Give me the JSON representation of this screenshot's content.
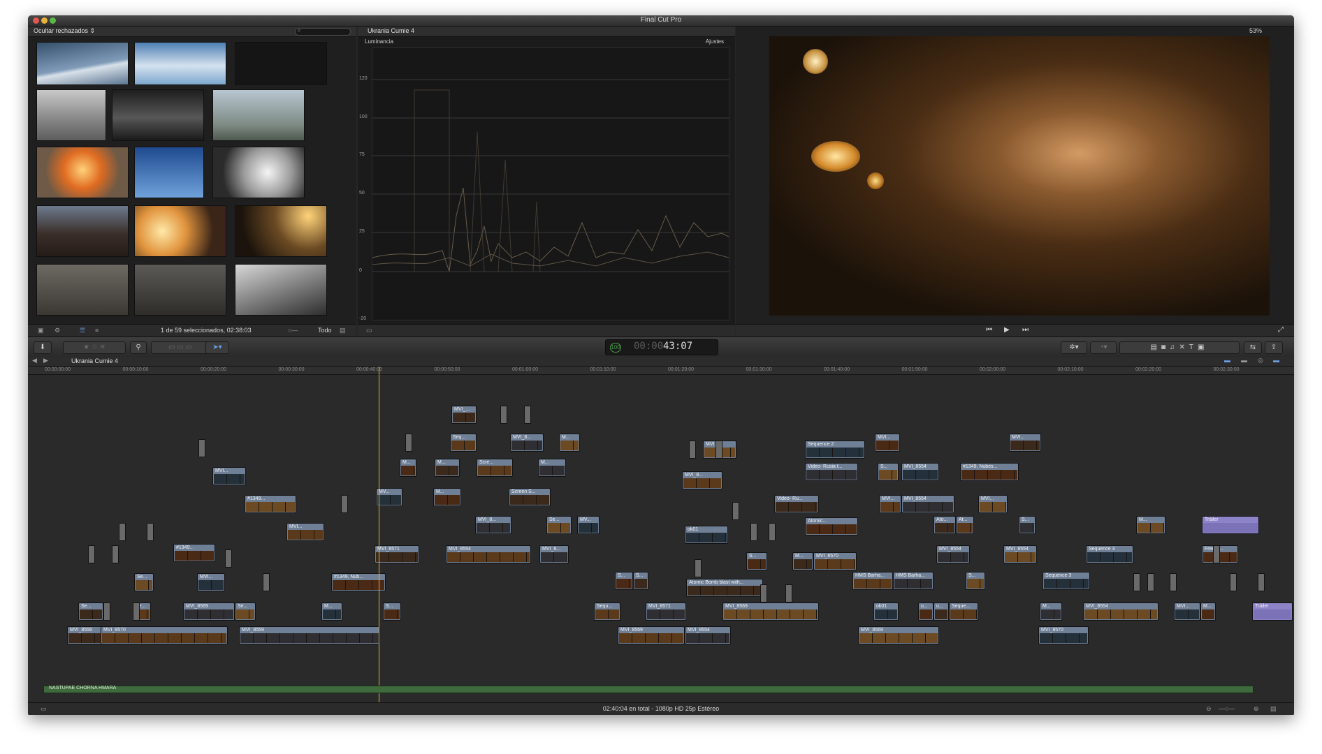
{
  "app": {
    "title": "Final Cut Pro"
  },
  "browser": {
    "filter_label": "Ocultar rechazados",
    "filter_arrows": "⇕",
    "search_icon": "search-icon",
    "selection_info": "1 de 59 seleccionados, 02:38:03",
    "all_label": "Todo"
  },
  "scope": {
    "project_name": "Ukrania Cumie 4",
    "title": "Luminancia",
    "adjust_label": "Ajustes",
    "y_ticks": [
      "120",
      "100",
      "75",
      "50",
      "25",
      "0",
      "-20"
    ]
  },
  "viewer": {
    "zoom": "53%"
  },
  "toolbar": {
    "timecode_dim": "00:00",
    "timecode": "43:07",
    "timecode_icon": "100"
  },
  "timeline": {
    "project_name": "Ukrania Cumie 4",
    "ruler": [
      "00:00:00:00",
      "00:00:10:00",
      "00:00:20:00",
      "00:00:30:00",
      "00:00:40:00",
      "00:00:50:00",
      "00:01:00:00",
      "00:01:10:00",
      "00:01:20:00",
      "00:01:30:00",
      "00:01:40:00",
      "00:01:50:00",
      "00:02:00:00",
      "00:02:10:00",
      "00:02:20:00",
      "00:02:30:00"
    ],
    "audio_clip": "NASTUPAE CHORNA HMARA",
    "clips": [
      {
        "label": "MVI_...",
        "x": 606,
        "y": 36,
        "w": 34
      },
      {
        "label": "Seq...",
        "x": 604,
        "y": 76,
        "w": 36
      },
      {
        "label": "MVI_8...",
        "x": 690,
        "y": 76,
        "w": 46
      },
      {
        "label": "M...",
        "x": 760,
        "y": 76,
        "w": 28
      },
      {
        "label": "MVI...",
        "x": 264,
        "y": 124,
        "w": 46
      },
      {
        "label": "M...",
        "x": 532,
        "y": 112,
        "w": 22
      },
      {
        "label": "M...",
        "x": 582,
        "y": 112,
        "w": 34
      },
      {
        "label": "Scre...",
        "x": 642,
        "y": 112,
        "w": 50
      },
      {
        "label": "M...",
        "x": 730,
        "y": 112,
        "w": 38
      },
      {
        "label": "#1349...",
        "x": 310,
        "y": 164,
        "w": 72
      },
      {
        "label": "MV...",
        "x": 498,
        "y": 154,
        "w": 36
      },
      {
        "label": "M...",
        "x": 580,
        "y": 154,
        "w": 38
      },
      {
        "label": "Screen S...",
        "x": 688,
        "y": 154,
        "w": 58
      },
      {
        "label": "MVI...",
        "x": 370,
        "y": 204,
        "w": 52
      },
      {
        "label": "MVI_8...",
        "x": 640,
        "y": 194,
        "w": 50
      },
      {
        "label": "Se...",
        "x": 742,
        "y": 194,
        "w": 34
      },
      {
        "label": "MV...",
        "x": 786,
        "y": 194,
        "w": 30
      },
      {
        "label": "#1349...",
        "x": 208,
        "y": 234,
        "w": 58
      },
      {
        "label": "MVI_8571",
        "x": 496,
        "y": 236,
        "w": 62
      },
      {
        "label": "MVI_8554",
        "x": 598,
        "y": 236,
        "w": 120
      },
      {
        "label": "MVI_8...",
        "x": 732,
        "y": 236,
        "w": 40
      },
      {
        "label": "Se...",
        "x": 152,
        "y": 276,
        "w": 26
      },
      {
        "label": "MVI...",
        "x": 242,
        "y": 276,
        "w": 38
      },
      {
        "label": "#1349, Nub...",
        "x": 434,
        "y": 276,
        "w": 76
      },
      {
        "label": "Se...",
        "x": 72,
        "y": 318,
        "w": 34
      },
      {
        "label": "Pe...",
        "x": 150,
        "y": 318,
        "w": 24
      },
      {
        "label": "MVI_8569",
        "x": 222,
        "y": 318,
        "w": 72
      },
      {
        "label": "Se...",
        "x": 296,
        "y": 318,
        "w": 28
      },
      {
        "label": "M...",
        "x": 420,
        "y": 318,
        "w": 28
      },
      {
        "label": "S...",
        "x": 508,
        "y": 318,
        "w": 24
      },
      {
        "label": "MVI_8556",
        "x": 56,
        "y": 352,
        "w": 48
      },
      {
        "label": "MVI_8570",
        "x": 104,
        "y": 352,
        "w": 180
      },
      {
        "label": "MVI_8559",
        "x": 302,
        "y": 352,
        "w": 200
      },
      {
        "label": "MVI...",
        "x": 966,
        "y": 86,
        "w": 46
      },
      {
        "label": "Sequence 2",
        "x": 1112,
        "y": 86,
        "w": 84
      },
      {
        "label": "MVI...",
        "x": 1212,
        "y": 76,
        "w": 34
      },
      {
        "label": "MVI...",
        "x": 1404,
        "y": 76,
        "w": 44
      },
      {
        "label": "MVI_8...",
        "x": 936,
        "y": 130,
        "w": 56
      },
      {
        "label": "Video- Rusia t...",
        "x": 1112,
        "y": 118,
        "w": 74
      },
      {
        "label": "S...",
        "x": 1216,
        "y": 118,
        "w": 28
      },
      {
        "label": "MVI_8554",
        "x": 1250,
        "y": 118,
        "w": 52
      },
      {
        "label": "#1349, Nubes...",
        "x": 1334,
        "y": 118,
        "w": 82
      },
      {
        "label": "Video- Ru...",
        "x": 1068,
        "y": 164,
        "w": 62
      },
      {
        "label": "MVI...",
        "x": 1218,
        "y": 164,
        "w": 30
      },
      {
        "label": "MVI_8554",
        "x": 1250,
        "y": 164,
        "w": 74
      },
      {
        "label": "MVI...",
        "x": 1360,
        "y": 164,
        "w": 40
      },
      {
        "label": "ok01",
        "x": 940,
        "y": 208,
        "w": 60
      },
      {
        "label": "Atomic...",
        "x": 1112,
        "y": 196,
        "w": 74
      },
      {
        "label": "Ato...",
        "x": 1296,
        "y": 194,
        "w": 30
      },
      {
        "label": "At...",
        "x": 1328,
        "y": 194,
        "w": 24
      },
      {
        "label": "S...",
        "x": 1418,
        "y": 194,
        "w": 22
      },
      {
        "label": "M...",
        "x": 1586,
        "y": 194,
        "w": 40
      },
      {
        "label": "Tráiler",
        "x": 1680,
        "y": 194,
        "w": 80
      },
      {
        "label": "S...",
        "x": 1028,
        "y": 246,
        "w": 28
      },
      {
        "label": "M...",
        "x": 1094,
        "y": 246,
        "w": 28
      },
      {
        "label": "MVI_8570",
        "x": 1124,
        "y": 246,
        "w": 60
      },
      {
        "label": "MVI_8554",
        "x": 1300,
        "y": 236,
        "w": 46
      },
      {
        "label": "MVI_8554",
        "x": 1396,
        "y": 236,
        "w": 46
      },
      {
        "label": "Sequence 3",
        "x": 1514,
        "y": 236,
        "w": 66
      },
      {
        "label": "Free E...",
        "x": 1680,
        "y": 236,
        "w": 50
      },
      {
        "label": "Atomic Bomb blast with...",
        "x": 942,
        "y": 284,
        "w": 108
      },
      {
        "label": "HMS Barha...",
        "x": 1180,
        "y": 274,
        "w": 56
      },
      {
        "label": "HMS Barha...",
        "x": 1238,
        "y": 274,
        "w": 56
      },
      {
        "label": "S...",
        "x": 1342,
        "y": 274,
        "w": 26
      },
      {
        "label": "Sequence 3",
        "x": 1452,
        "y": 274,
        "w": 66
      },
      {
        "label": "S...",
        "x": 840,
        "y": 274,
        "w": 24
      },
      {
        "label": "S...",
        "x": 866,
        "y": 274,
        "w": 20
      },
      {
        "label": "Sequ...",
        "x": 810,
        "y": 318,
        "w": 36
      },
      {
        "label": "MVI_8571",
        "x": 884,
        "y": 318,
        "w": 56
      },
      {
        "label": "MVI_8569",
        "x": 994,
        "y": 318,
        "w": 136
      },
      {
        "label": "ok01",
        "x": 1210,
        "y": 318,
        "w": 34
      },
      {
        "label": "u...",
        "x": 1274,
        "y": 318,
        "w": 20
      },
      {
        "label": "u...",
        "x": 1296,
        "y": 318,
        "w": 20
      },
      {
        "label": "Seque...",
        "x": 1318,
        "y": 318,
        "w": 40
      },
      {
        "label": "M...",
        "x": 1448,
        "y": 318,
        "w": 30
      },
      {
        "label": "MVI_8554",
        "x": 1510,
        "y": 318,
        "w": 106
      },
      {
        "label": "MVI...",
        "x": 1640,
        "y": 318,
        "w": 36
      },
      {
        "label": "M...",
        "x": 1678,
        "y": 318,
        "w": 20
      },
      {
        "label": "Tráiler",
        "x": 1752,
        "y": 318,
        "w": 56
      },
      {
        "label": "MVI_8569",
        "x": 844,
        "y": 352,
        "w": 94
      },
      {
        "label": "MVI_8554",
        "x": 940,
        "y": 352,
        "w": 64
      },
      {
        "label": "MVI_8569",
        "x": 1188,
        "y": 352,
        "w": 114
      },
      {
        "label": "MVI_8570",
        "x": 1446,
        "y": 352,
        "w": 70
      }
    ],
    "status": "02:40:04 en total - 1080p HD 25p Estéreo"
  }
}
